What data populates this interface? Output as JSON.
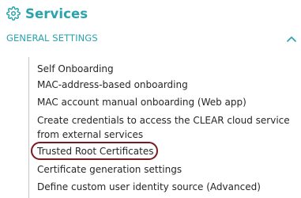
{
  "header": {
    "title": "Services",
    "icon": "gear-icon"
  },
  "section": {
    "label": "GENERAL SETTINGS",
    "expanded": true,
    "toggle_icon": "chevron-up-icon"
  },
  "nav": {
    "items": [
      {
        "label": "Self Onboarding"
      },
      {
        "label": "MAC-address-based onboarding"
      },
      {
        "label": "MAC account manual onboarding (Web app)"
      },
      {
        "label": "Create credentials to access the CLEAR cloud service from external services"
      },
      {
        "label": "Trusted Root Certificates",
        "highlighted": true
      },
      {
        "label": "Certificate generation settings"
      },
      {
        "label": "Define custom user identity source (Advanced)"
      }
    ]
  },
  "colors": {
    "accent": "#2aa3ad",
    "text": "#262626",
    "highlight_ring": "#7a1a1f",
    "divider": "#c9c9c9"
  }
}
